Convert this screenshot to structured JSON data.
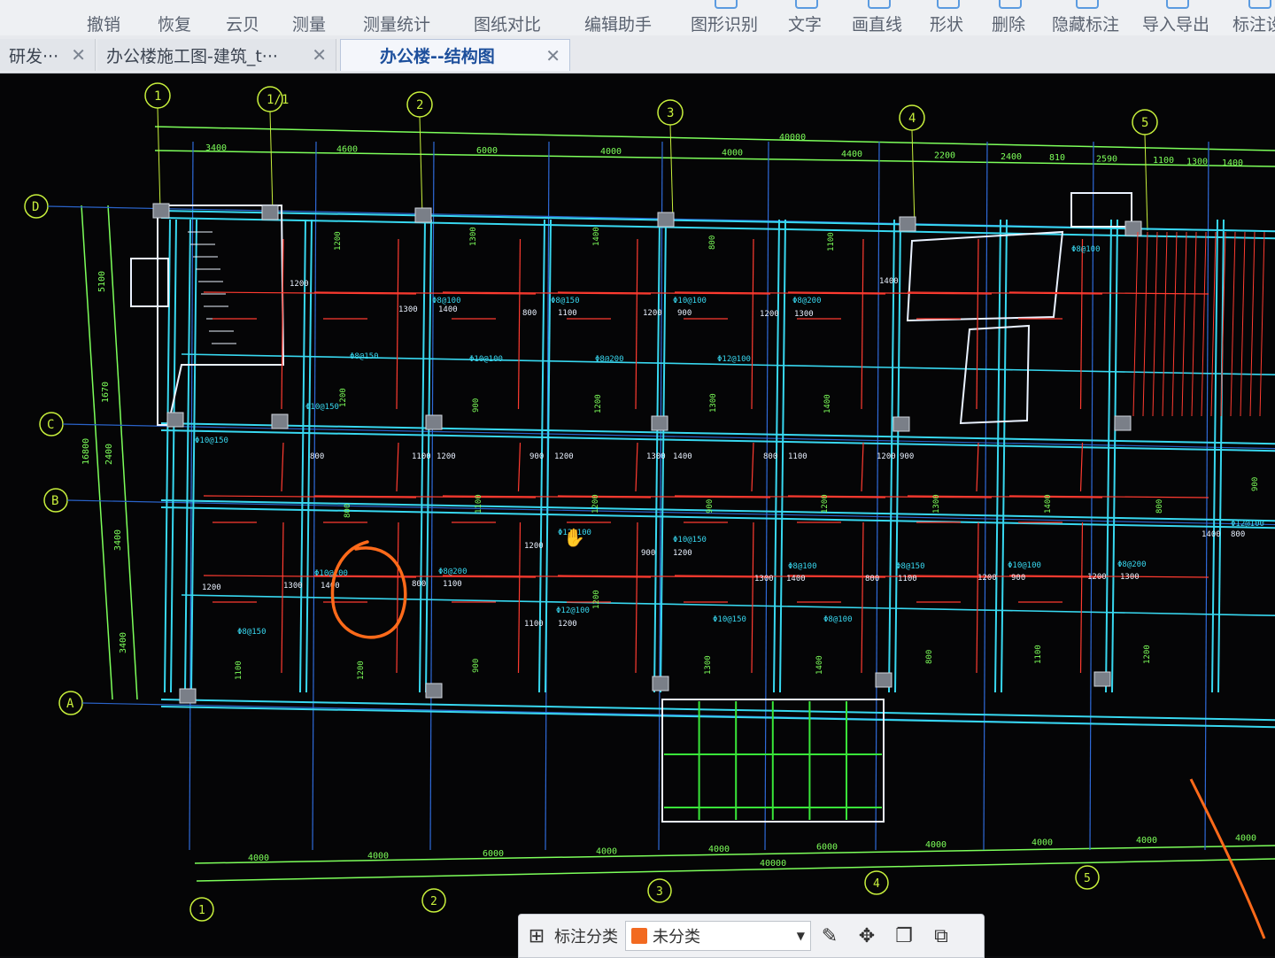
{
  "toolbar": {
    "items": [
      "撤销",
      "恢复",
      "云贝",
      "测量",
      "测量统计",
      "图纸对比",
      "编辑助手",
      "图形识别",
      "文字",
      "画直线",
      "形状",
      "删除",
      "隐藏标注",
      "导入导出",
      "标注设"
    ]
  },
  "tabs": [
    {
      "label": "研发···",
      "active": false
    },
    {
      "label": "办公楼施工图-建筑_t···",
      "active": false
    },
    {
      "label": "办公楼--结构图",
      "active": true
    }
  ],
  "drawing": {
    "axis_top": [
      "1",
      "1/1",
      "2",
      "3",
      "4",
      "5"
    ],
    "axis_bottom": [
      "1",
      "2",
      "3",
      "4",
      "5"
    ],
    "axis_left": [
      "D",
      "C",
      "B",
      "A"
    ],
    "top_total": "40000",
    "top_spans": [
      "3400",
      "4600",
      "6000",
      "4000",
      "4000",
      "4400",
      "2200",
      "2400",
      "810",
      "2590",
      "1100",
      "1300",
      "1400"
    ],
    "bottom_spans": [
      "4000",
      "4000",
      "6000",
      "4000",
      "4000",
      "6000",
      "4000",
      "4000",
      "4000",
      "4000"
    ],
    "bottom_total": "40000",
    "left_spans": [
      "5100",
      "1670",
      "2400",
      "3400",
      "3400"
    ],
    "left_total": "16800",
    "rebar_labels": [
      "Φ8@150",
      "Φ10@100",
      "Φ8@200",
      "Φ12@100",
      "Φ10@150",
      "Φ8@100"
    ],
    "length_labels": [
      "1200",
      "1300",
      "1400",
      "800",
      "1100",
      "1200",
      "900"
    ],
    "colors": {
      "grid": "#c8f03c",
      "beam": "#38d8f0",
      "wall": "#eaf2ff",
      "rebar": "#ff3b30",
      "dim": "#7dff5a",
      "markup": "#ff6a1a"
    }
  },
  "bottombar": {
    "label": "标注分类",
    "selected": "未分类",
    "swatch": "#f26a21",
    "buttons": [
      "edit-icon",
      "move-icon",
      "copy-icon",
      "paste-icon"
    ]
  }
}
